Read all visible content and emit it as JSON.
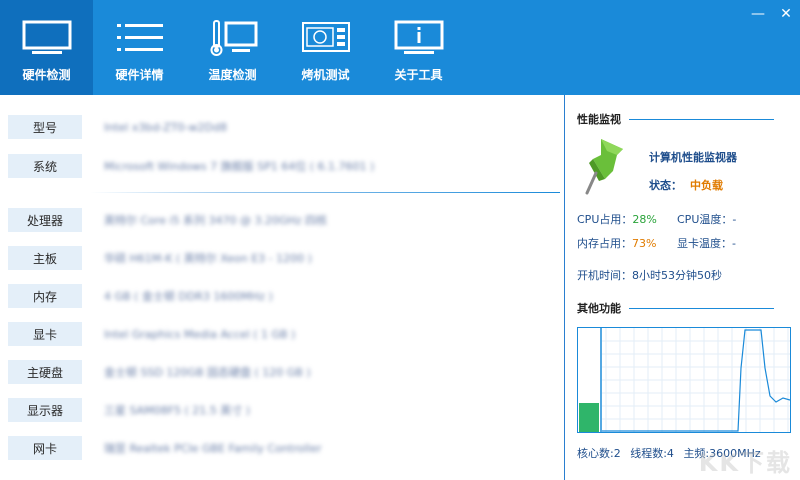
{
  "window": {
    "min_icon": "minimize-icon",
    "close_icon": "close-icon",
    "min_glyph": "—",
    "close_glyph": "✕"
  },
  "tabs": [
    {
      "label": "硬件检测",
      "icon": "monitor-icon"
    },
    {
      "label": "硬件详情",
      "icon": "list-icon"
    },
    {
      "label": "温度检测",
      "icon": "thermometer-icon"
    },
    {
      "label": "烤机测试",
      "icon": "gpu-card-icon"
    },
    {
      "label": "关于工具",
      "icon": "info-icon"
    }
  ],
  "hardware": [
    {
      "label": "型号",
      "value": "Intel x3bd-ZT0-w2Dd8"
    },
    {
      "label": "系统",
      "value": "Microsoft Windows 7 旗舰版 SP1 64位 ( 6.1.7601 )"
    },
    {
      "label": "处理器",
      "value": "英特尔 Core i5 系列 3470 @ 3.20GHz 四核"
    },
    {
      "label": "主板",
      "value": "华硕 H61M-K ( 英特尔 Xeon E3 - 1200 )"
    },
    {
      "label": "内存",
      "value": "4 GB ( 金士顿 DDR3 1600MHz )"
    },
    {
      "label": "显卡",
      "value": "Intel Graphics Media Accel ( 1 GB )"
    },
    {
      "label": "主硬盘",
      "value": "金士顿 SSD 120GB 固态硬盘 ( 120 GB )"
    },
    {
      "label": "显示器",
      "value": "三星 SAM08F5 ( 21.5 英寸 )"
    },
    {
      "label": "网卡",
      "value": "瑞昱 Realtek PCIe GBE Family Controller"
    }
  ],
  "monitor": {
    "section_title": "性能监视",
    "title": "计算机性能监视器",
    "status_label": "状态：",
    "status_value": "中负载",
    "cpu_usage_label": "CPU占用：",
    "cpu_usage_value": "28%",
    "cpu_temp_label": "CPU温度：",
    "cpu_temp_value": "-",
    "mem_usage_label": "内存占用：",
    "mem_usage_value": "73%",
    "gpu_temp_label": "显卡温度：",
    "gpu_temp_value": "-",
    "uptime_label": "开机时间：",
    "uptime_value": "8小时53分钟50秒"
  },
  "other": {
    "section_title": "其他功能",
    "bar_level": 0.28,
    "cores": "核心数:2",
    "threads": "线程数:4",
    "freq": "主频:3600MHz"
  },
  "colors": {
    "accent": "#1a8ad9",
    "accent_dark": "#0f6fbd",
    "green": "#2aa33a",
    "orange": "#e07b00"
  },
  "watermark": "KK下载"
}
